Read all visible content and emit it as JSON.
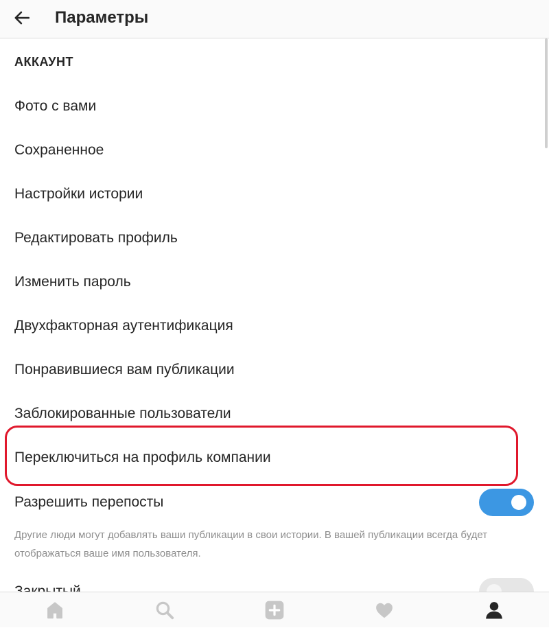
{
  "header": {
    "title": "Параметры",
    "back_icon": "arrow-left-icon"
  },
  "section": {
    "title": "АККАУНТ"
  },
  "menu_items": [
    "Фото с вами",
    "Сохраненное",
    "Настройки истории",
    "Редактировать профиль",
    "Изменить пароль",
    "Двухфакторная аутентификация",
    "Понравившиеся вам публикации",
    "Заблокированные пользователи",
    "Переключиться на профиль компании"
  ],
  "toggle_setting": {
    "label": "Разрешить перепосты",
    "enabled": true,
    "description": "Другие люди могут добавлять ваши публикации в свои истории. В вашей публикации всегда будет отображаться ваше имя пользователя."
  },
  "partial_setting": {
    "label": "Закрытый",
    "enabled": false
  },
  "bottom_nav": [
    "home-icon",
    "search-icon",
    "add-post-icon",
    "heart-icon",
    "profile-icon"
  ],
  "colors": {
    "toggle_on": "#3c97e3",
    "highlight": "#e0182c",
    "muted_text": "#8e8e8e"
  }
}
